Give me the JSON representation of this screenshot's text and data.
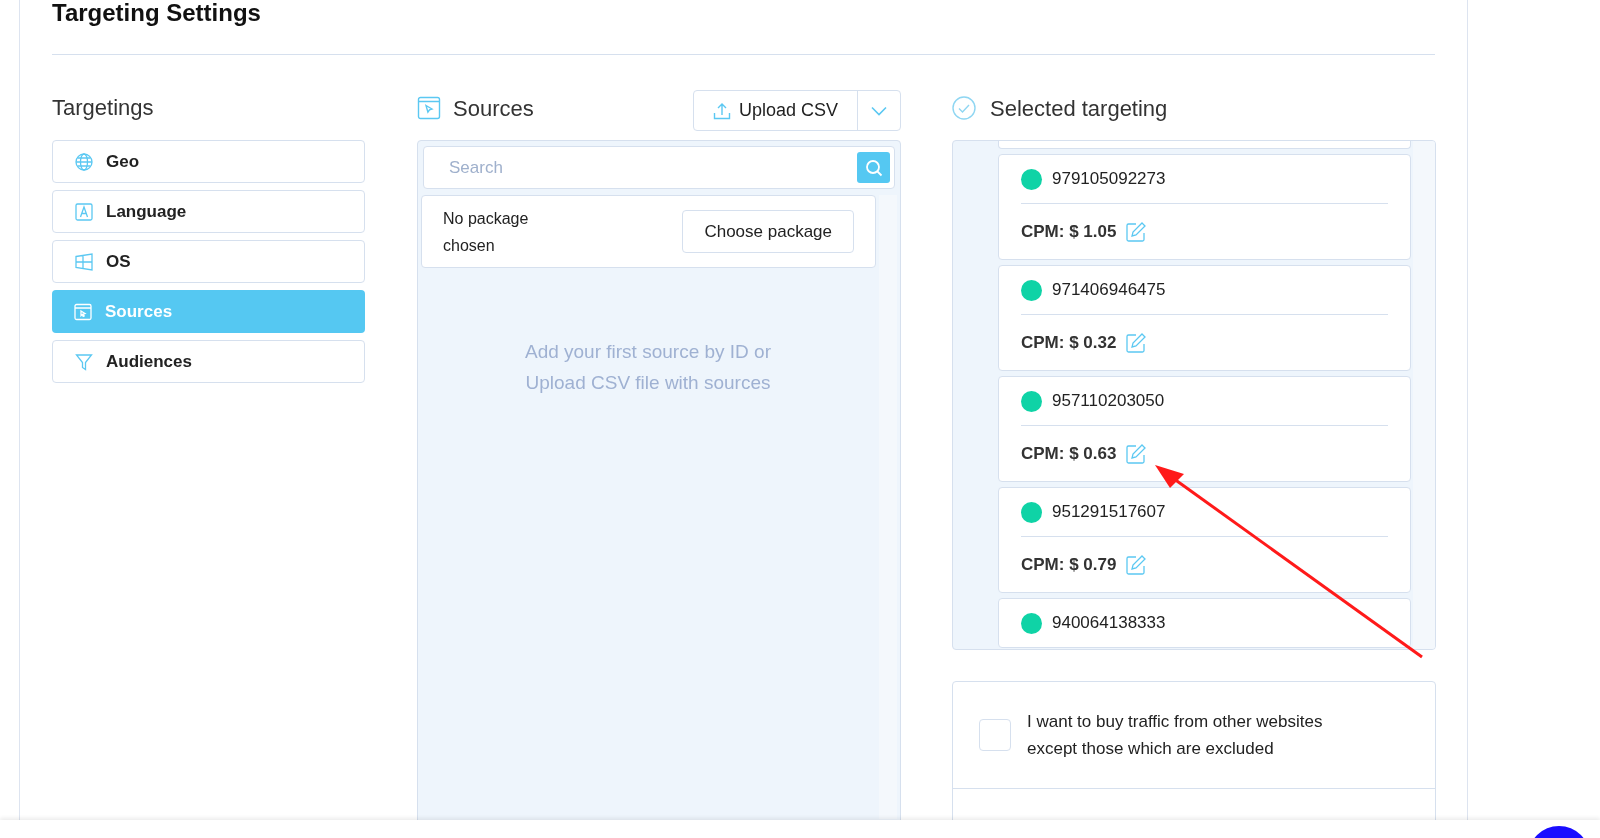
{
  "title": "Targeting Settings",
  "targetings": {
    "heading": "Targetings",
    "items": [
      {
        "label": "Geo",
        "kind": "globe",
        "selected": false
      },
      {
        "label": "Language",
        "kind": "letter",
        "selected": false
      },
      {
        "label": "OS",
        "kind": "windows",
        "selected": false
      },
      {
        "label": "Sources",
        "kind": "browser",
        "selected": true
      },
      {
        "label": "Audiences",
        "kind": "funnel",
        "selected": false
      }
    ]
  },
  "sources": {
    "heading": "Sources",
    "upload_button": "Upload CSV",
    "search": {
      "placeholder": "Search"
    },
    "package": {
      "text": "No package chosen",
      "button": "Choose package"
    },
    "empty_hint": "Add your first source by ID or Upload CSV file with sources"
  },
  "selected_targeting": {
    "heading": "Selected targeting",
    "items": [
      {
        "id": "979105092273",
        "cpm": "CPM: $ 1.05"
      },
      {
        "id": "971406946475",
        "cpm": "CPM: $ 0.32"
      },
      {
        "id": "957110203050",
        "cpm": "CPM: $ 0.63"
      },
      {
        "id": "951291517607",
        "cpm": "CPM: $ 0.79"
      },
      {
        "id": "940064138333"
      }
    ]
  },
  "exclude_option": {
    "label": "I want to buy traffic from other websites except those which are excluded",
    "checked": false
  }
}
